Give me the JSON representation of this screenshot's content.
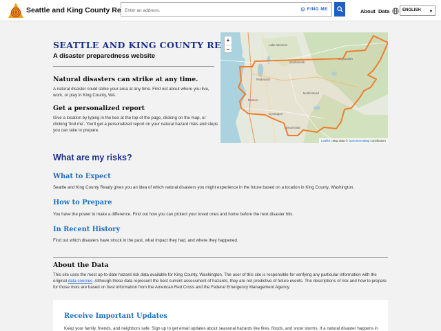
{
  "header": {
    "brand": "Seattle and King County Ready",
    "search_placeholder": "Enter an address.",
    "find_me": "FIND ME",
    "nav_about": "About",
    "nav_data": "Data",
    "language": "ENGLISH"
  },
  "hero": {
    "title": "SEATTLE AND KING COUNTY READY",
    "subtitle": "A disaster preparedness website"
  },
  "intro": {
    "natural_heading": "Natural disasters can strike at any time.",
    "natural_text": "A natural disaster could strike your area at any time. Find out about where you live, work, or play in King County, WA.",
    "personal_heading": "Get a personalized report",
    "personal_text": "Give a location by typing in the box at the top of the page, clicking on the map, or clicking 'find me'. You'll get a personalized report on your natural hazard risks and steps you can take to prepare."
  },
  "map": {
    "zoom_in": "+",
    "zoom_out": "−",
    "attribution_leaflet": "Leaflet",
    "attribution_sep": " | Map data © ",
    "attribution_osm": "OpenStreetMap",
    "attribution_end": " contributors",
    "boundary_color": "#f07d2d"
  },
  "risks": {
    "heading": "What are my risks?",
    "sections": [
      {
        "title": "What to Expect",
        "text": "Seattle and King County Ready gives you an idea of which natural disasters you might experience in the future based on a location in King County, Washington."
      },
      {
        "title": "How to Prepare",
        "text": "You have the power to make a difference. Find out how you can protect your loved ones and home before the next disaster hits."
      },
      {
        "title": "In Recent History",
        "text": "Find out which disasters have struck in the past, what impact they had, and where they happened."
      }
    ]
  },
  "about": {
    "heading": "About the Data",
    "text_1": "This site uses the most up-to-date hazard risk data available for King County, Washington. The user of this site is responsible for verifying any particular information with the original ",
    "link": "data sources",
    "text_2": ". Although these data represent the best current assessment of hazards, they are not predictive of future events. The descriptions of risk and how to prepare for those risks are based on best information from the American Red Cross and the Federal Emergency Management Agency."
  },
  "updates": {
    "heading": "Receive Important Updates",
    "text": "Keep your family, friends, and neighbors safe. Sign up to get email updates about seasonal hazards like fires, floods, and snow storms. If a natural disaster happens in"
  },
  "colors": {
    "primary_blue": "#1f5fc6",
    "heading_navy": "#1b2f8a",
    "logo_orange": "#e8a51c",
    "logo_red": "#c8331d"
  }
}
